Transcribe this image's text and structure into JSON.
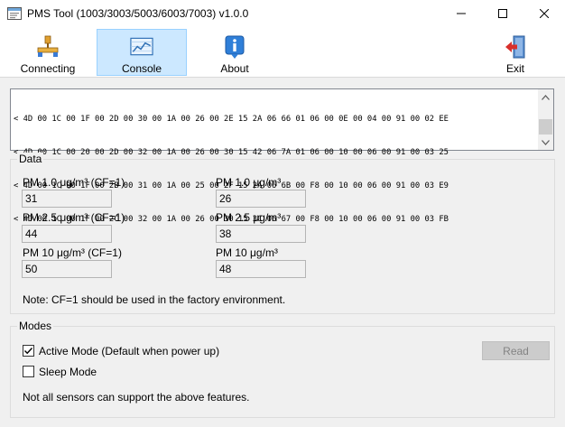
{
  "window": {
    "title": "PMS Tool (1003/3003/5003/6003/7003) v1.0.0"
  },
  "toolbar": {
    "connecting_label": "Connecting",
    "console_label": "Console",
    "about_label": "About",
    "exit_label": "Exit"
  },
  "console": {
    "lines": [
      "< 4D 00 1C 00 1F 00 2D 00 30 00 1A 00 26 00 2E 15 2A 06 66 01 06 00 0E 00 04 00 91 00 02 EE",
      "< 4D 00 1C 00 20 00 2D 00 32 00 1A 00 26 00 30 15 42 06 7A 01 06 00 10 00 06 00 91 00 03 25",
      "< 4D 00 1C 00 1F 00 2B 00 31 00 1A 00 25 00 2F 15 2A 06 6B 00 F8 00 10 00 06 00 91 00 03 E9",
      "< 4D 00 1C 00 1F 00 2C 00 32 00 1A 00 26 00 30 15 3C 06 67 00 F8 00 10 00 06 00 91 00 03 FB"
    ]
  },
  "data": {
    "title": "Data",
    "pm1_cf1_label": "PM 1.0 μg/m³ (CF=1)",
    "pm1_cf1_value": "31",
    "pm25_cf1_label": "PM 2.5 μg/m³ (CF=1)",
    "pm25_cf1_value": "44",
    "pm10_cf1_label": "PM 10 μg/m³ (CF=1)",
    "pm10_cf1_value": "50",
    "pm1_label": "PM 1.0 μg/m³",
    "pm1_value": "26",
    "pm25_label": "PM 2.5 μg/m³",
    "pm25_value": "38",
    "pm10_label": "PM 10 μg/m³",
    "pm10_value": "48",
    "note": "Note: CF=1 should be used in the factory environment."
  },
  "modes": {
    "title": "Modes",
    "active_label": "Active Mode (Default when power up)",
    "active_checked": true,
    "sleep_label": "Sleep Mode",
    "sleep_checked": false,
    "read_label": "Read",
    "note": "Not all sensors can support the above features."
  }
}
